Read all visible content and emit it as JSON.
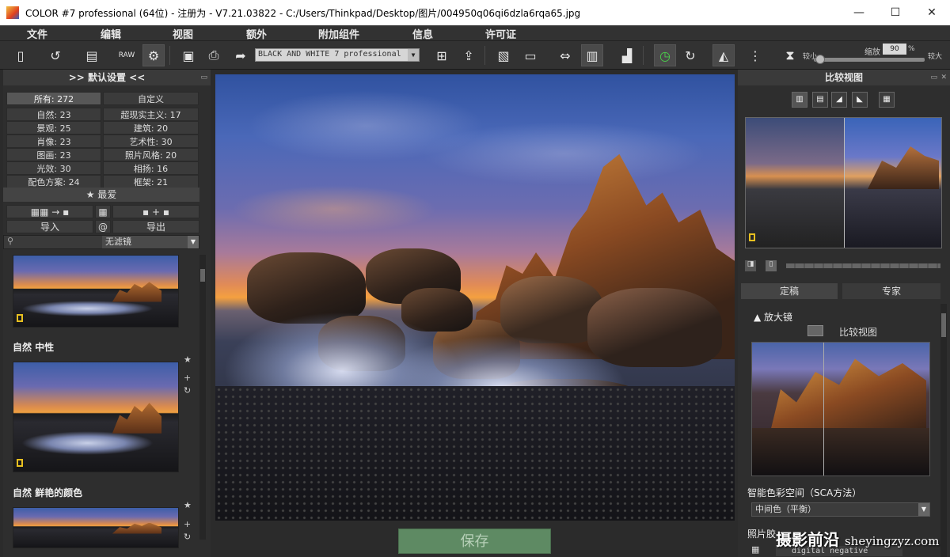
{
  "window": {
    "title": "COLOR #7 professional (64位) - 注册为 - V7.21.03822 - C:/Users/Thinkpad/Desktop/图片/004950q06qi6dzla6rqa65.jpg",
    "minimize": "—",
    "maximize": "☐",
    "close": "✕"
  },
  "menu": [
    "文件",
    "编辑",
    "视图",
    "额外",
    "附加组件",
    "信息",
    "许可证"
  ],
  "toolbar": {
    "preset_value": "BLACK AND WHITE 7 professional",
    "zoom_label": "缩放",
    "zoom_value": "90",
    "zoom_unit": "%",
    "zoom_small": "较小",
    "zoom_large": "较大"
  },
  "left_panel": {
    "title": ">> 默认设置 <<",
    "tab_all": "所有: 272",
    "tab_custom": "自定义",
    "categories": [
      {
        "left": "自然: 23",
        "right": "超现实主义: 17"
      },
      {
        "left": "景观: 25",
        "right": "建筑: 20"
      },
      {
        "left": "肖像: 23",
        "right": "艺术性: 30"
      },
      {
        "left": "图画: 23",
        "right": "照片风格: 20"
      },
      {
        "left": "光效: 30",
        "right": "相扬: 16"
      },
      {
        "left": "配色方案: 24",
        "right": "框架: 21"
      }
    ],
    "favorites": "★ 最爱",
    "import_label": "导入",
    "at_label": "@",
    "export_label": "导出",
    "filter_value": "无滤镜",
    "presets": [
      {
        "label": "自然 中性"
      },
      {
        "label": "自然 鲜艳的颜色"
      }
    ]
  },
  "save_label": "保存",
  "right_panel": {
    "title": "比较视图",
    "tab_final": "定稿",
    "tab_expert": "专家",
    "magnifier_label": "▲ 放大镜",
    "compare_label": "比较视图",
    "smart_color_label": "智能色彩空间（SCA方法）",
    "smart_color_value": "中间色（平衡）",
    "film_label": "照片胶",
    "film_value": "digital negative"
  },
  "watermark": {
    "cn": "摄影前沿",
    "en": "sheyingzyz.com"
  }
}
